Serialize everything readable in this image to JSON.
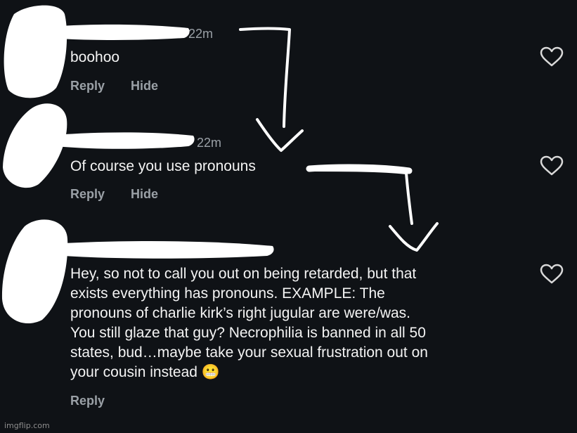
{
  "comments": [
    {
      "time": "22m",
      "text": "boohoo",
      "actions": [
        "Reply",
        "Hide"
      ]
    },
    {
      "time": "22m",
      "text": "Of course you use pronouns",
      "actions": [
        "Reply",
        "Hide"
      ]
    },
    {
      "time": "",
      "text": "Hey, so not to call you out on being retarded, but that\nexists everything has pronouns. EXAMPLE: The\npronouns of charlie kirk’s right jugular are were/was.\nYou still glaze that guy? Necrophilia is banned in all 50\nstates, bud…maybe take your sexual frustration out on\nyour cousin instead 😬",
      "actions": [
        "Reply"
      ]
    }
  ],
  "icons": {
    "like": "heart-outline-icon",
    "annotation_arrow": "hand-drawn-arrow"
  },
  "colors": {
    "background": "#0f1216",
    "text": "#f4f4f4",
    "muted": "#9aa0a6",
    "redaction": "#ffffff"
  },
  "watermark": "imgflip.com"
}
